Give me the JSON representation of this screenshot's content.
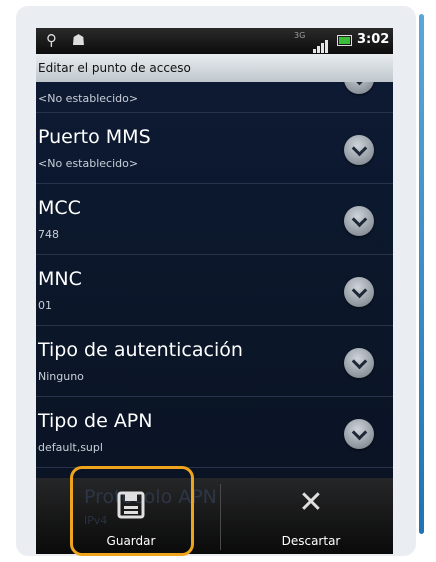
{
  "statusbar": {
    "usb_icon": "usb-icon",
    "android_icon": "android-icon",
    "network_type": "3G",
    "time": "3:02"
  },
  "titlebar": {
    "title": "Editar el punto de acceso"
  },
  "list": {
    "partial_item": {
      "value": "<No establecido>"
    },
    "items": [
      {
        "label": "Puerto MMS",
        "value": "<No establecido>"
      },
      {
        "label": "MCC",
        "value": "748"
      },
      {
        "label": "MNC",
        "value": "01"
      },
      {
        "label": "Tipo de autenticación",
        "value": "Ninguno"
      },
      {
        "label": "Tipo de APN",
        "value": "default,supl"
      }
    ],
    "hidden_item": {
      "label": "Protocolo APN",
      "value": "IPv4"
    }
  },
  "bottombar": {
    "save_label": "Guardar",
    "save_icon": "floppy-disk-icon",
    "discard_label": "Descartar",
    "discard_icon": "close-x-icon"
  },
  "colors": {
    "highlight": "#f0a31c",
    "list_bg": "#0b1628"
  }
}
